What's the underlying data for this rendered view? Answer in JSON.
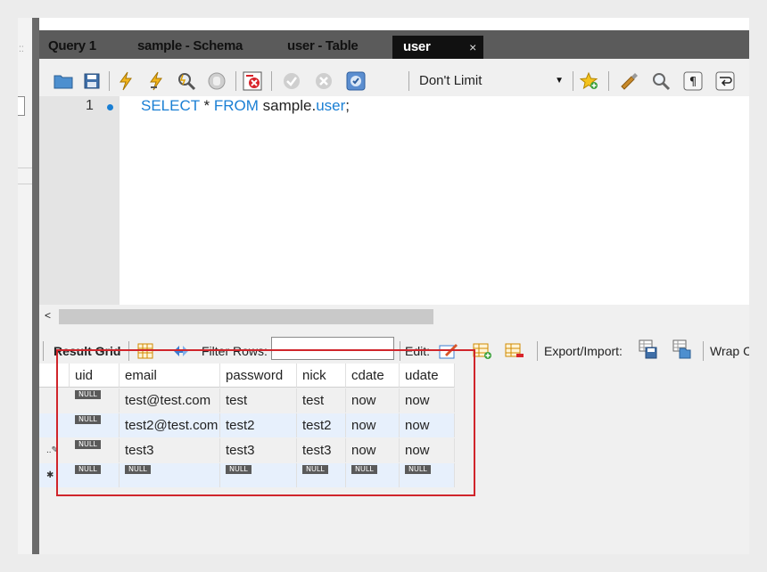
{
  "tabs": [
    {
      "label": "Query 1"
    },
    {
      "label": "sample - Schema"
    },
    {
      "label": "user - Table"
    },
    {
      "label": "user",
      "active": true
    }
  ],
  "tab_close": "×",
  "toolbar": {
    "limit_value": "Don't Limit",
    "icons": [
      "folder-icon",
      "save-icon",
      "execute-icon",
      "execute-current-icon",
      "explain-icon",
      "stop-icon",
      "toggle-error-icon",
      "commit-icon",
      "rollback-icon",
      "autocommit-icon",
      "beautify-icon",
      "find-icon",
      "invisible-chars-icon",
      "wrap-icon",
      "bookmark-icon"
    ]
  },
  "editor": {
    "line_number": "1",
    "code_parts": [
      {
        "text": "SELECT",
        "kw": true
      },
      {
        "text": " * ",
        "kw": false
      },
      {
        "text": "FROM",
        "kw": true
      },
      {
        "text": " sample.",
        "kw": false
      },
      {
        "text": "user",
        "kw": true
      },
      {
        "text": ";",
        "kw": false
      }
    ]
  },
  "scroll_arrow": "<",
  "result_toolbar": {
    "result_grid": "Result Grid",
    "filter_rows": "Filter Rows:",
    "edit": "Edit:",
    "export_import": "Export/Import:",
    "wrap": "Wrap C"
  },
  "grid": {
    "columns": [
      "uid",
      "email",
      "password",
      "nick",
      "cdate",
      "udate"
    ],
    "null_label": "NULL",
    "rows": [
      [
        "NULL",
        "test@test.com",
        "test",
        "test",
        "now",
        "now"
      ],
      [
        "NULL",
        "test2@test.com",
        "test2",
        "test2",
        "now",
        "now"
      ],
      [
        "NULL",
        "test3",
        "test3",
        "test3",
        "now",
        "now"
      ],
      [
        "NULL",
        "NULL",
        "NULL",
        "NULL",
        "NULL",
        "NULL"
      ]
    ],
    "row_markers": [
      "",
      "",
      "..✎",
      "✱"
    ]
  },
  "colors": {
    "highlight": "#d0252b",
    "keyword": "#1a7fd4",
    "active_tab": "#111111"
  }
}
